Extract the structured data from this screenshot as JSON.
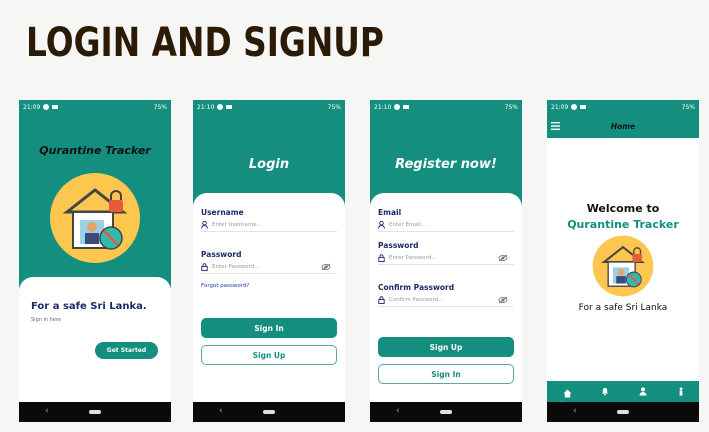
{
  "page": {
    "headline": "LOGIN AND SIGNUP"
  },
  "colors": {
    "teal": "#148f7f",
    "navy": "#1a2a6c",
    "headline": "#2b1a05"
  },
  "phones": {
    "splash": {
      "time": "21:09",
      "battery": "75%",
      "app_title": "Qurantine Tracker",
      "tagline": "For a safe Sri Lanka.",
      "sub": "Sign in here",
      "cta": "Get Started"
    },
    "login": {
      "time": "21:10",
      "battery": "75%",
      "title": "Login",
      "username_label": "Username",
      "username_placeholder": "Enter Username...",
      "password_label": "Password",
      "password_placeholder": "Enter Password...",
      "forgot": "Forgot password?",
      "signin": "Sign In",
      "signup": "Sign Up"
    },
    "register": {
      "time": "21:10",
      "battery": "75%",
      "title": "Register now!",
      "email_label": "Email",
      "email_placeholder": "Enter Email...",
      "password_label": "Password",
      "password_placeholder": "Enter Password...",
      "confirm_label": "Confirm Password",
      "confirm_placeholder": "Confirm Password...",
      "signup": "Sign Up",
      "signin": "Sign In"
    },
    "home": {
      "time": "21:09",
      "battery": "75%",
      "title": "Home",
      "welcome": "Welcome to",
      "app_title": "Qurantine Tracker",
      "tagline": "For a safe Sri Lanka",
      "nav": {
        "home": "Home"
      }
    }
  }
}
